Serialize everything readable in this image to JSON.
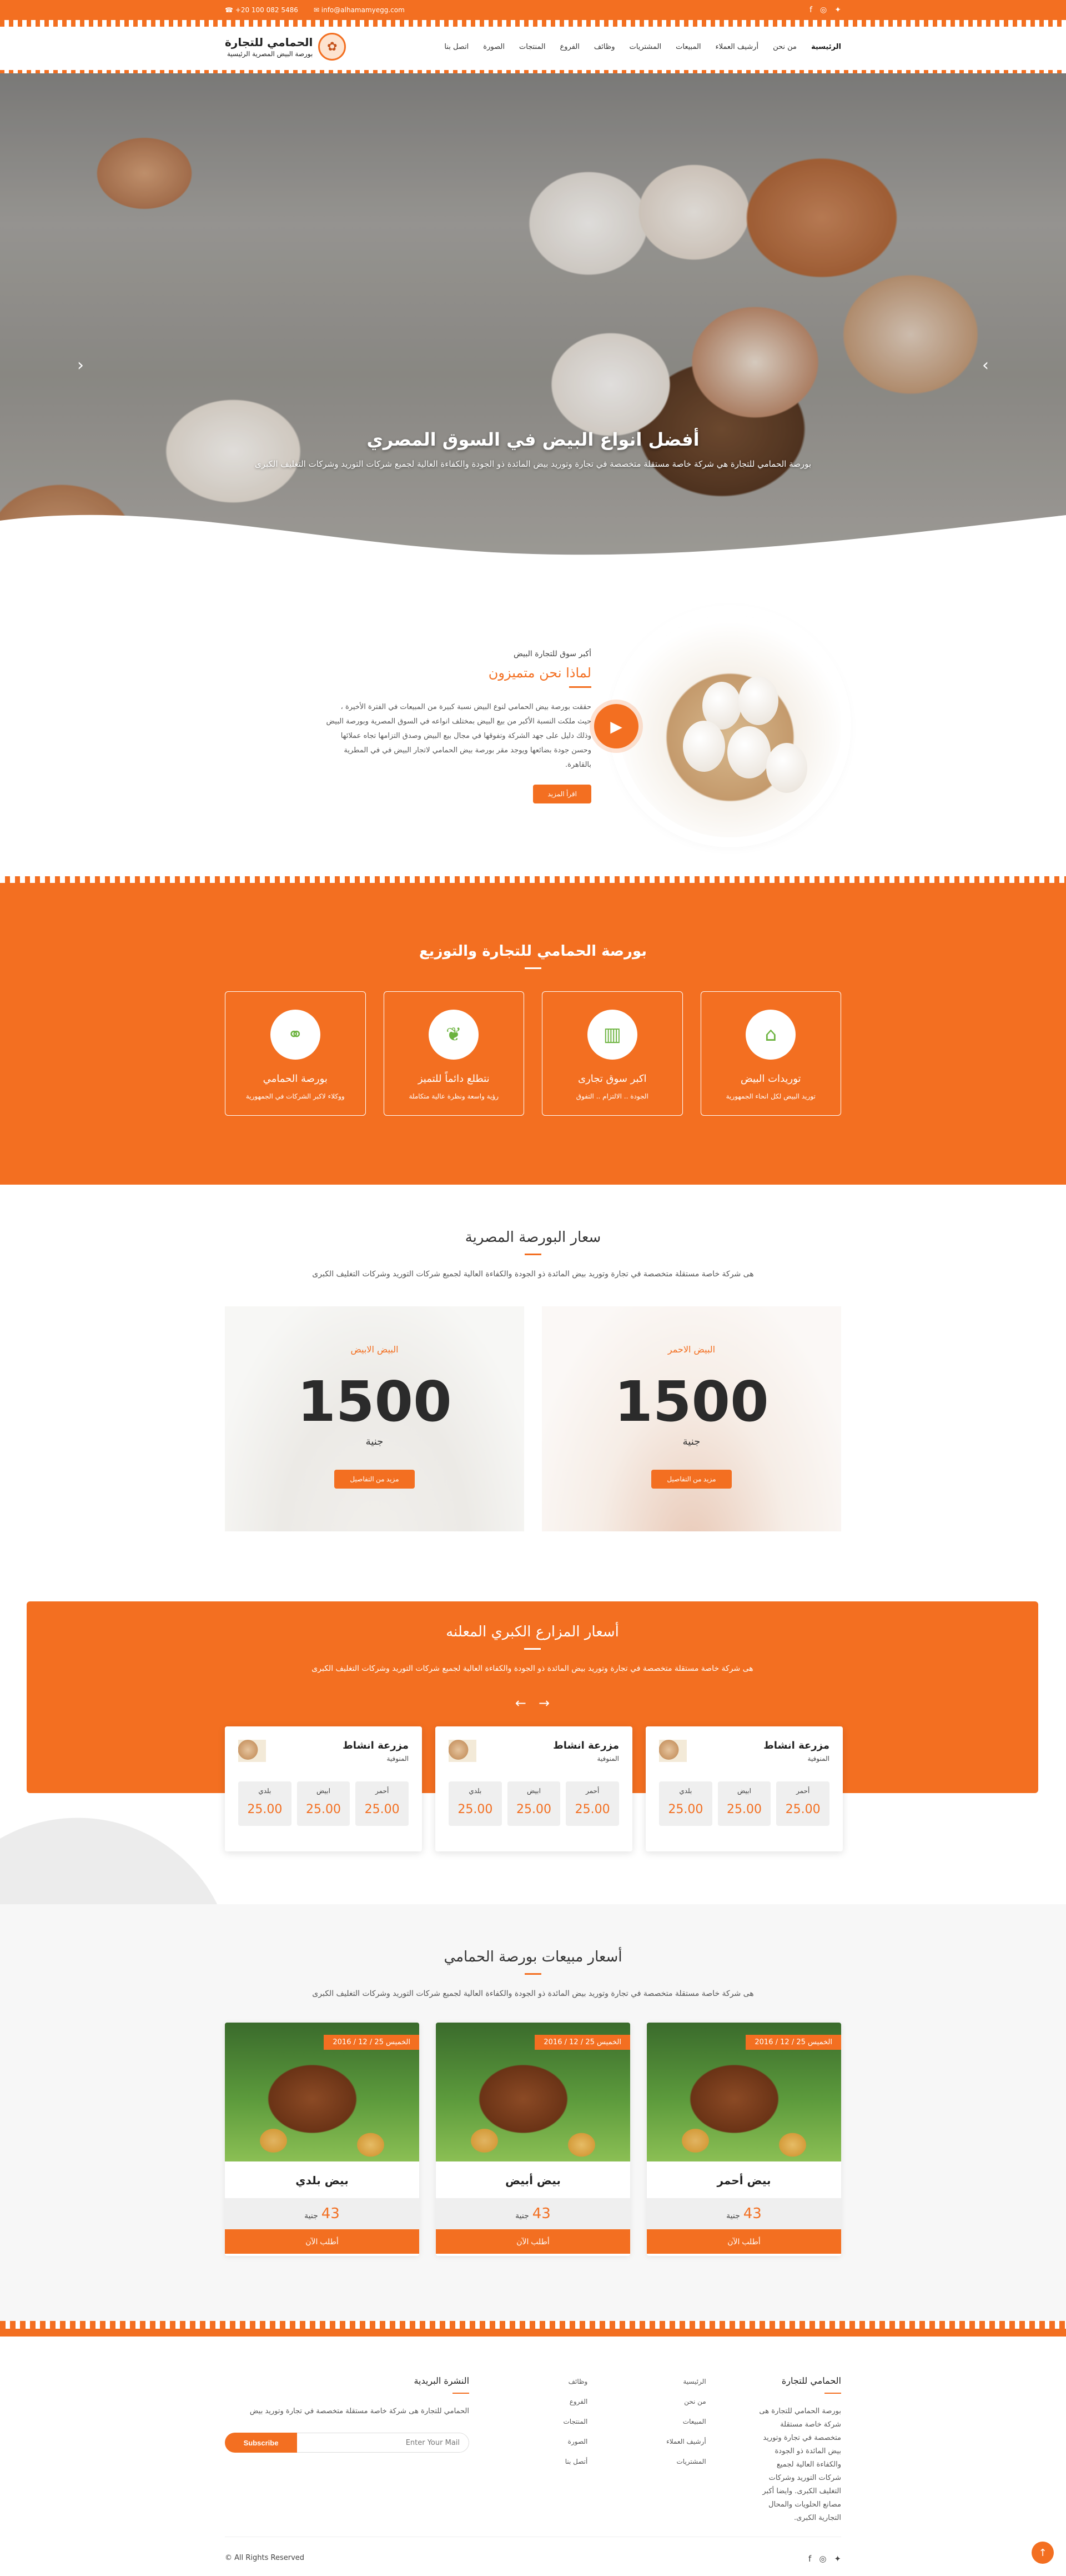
{
  "topbar": {
    "phone": "+20 100 082 5486",
    "email": "info@alhamamyegg.com",
    "social": [
      "facebook-icon",
      "instagram-icon",
      "twitter-icon"
    ]
  },
  "header": {
    "logo_title": "الحمامي للتجارة",
    "logo_subtitle": "بورصة البيض المصرية الرئيسية",
    "nav": [
      "الرئيسية",
      "من نحن",
      "أرشيف العملاء",
      "المبيعات",
      "المشتريات",
      "وظائف",
      "الفروع",
      "المنتجات",
      "الصورة",
      "اتصل بنا"
    ]
  },
  "hero": {
    "title": "أفضل انواع البيض في السوق المصري",
    "subtitle": "بورصة الحمامي للتجارة هي شركة خاصة مستقلة متخصصة في تجارة وتوريد بيض المائدة ذو الجودة والكفاءة العالية لجميع شركات التوريد وشركات التغليف الكبرى"
  },
  "about": {
    "subtitle": "أكبر سوق للتجارة البيض",
    "title": "لماذا نحن متميزون",
    "text": "حققت بورصة بيض الحمامي لنوع البيض نسبة كبيرة من المبيعات في الفترة الأخيرة ، حيث ملكت النسبة الأكبر من بيع البيض بمختلف انواعه في السوق المصرية وبورصة البيض وذلك دليل على جهد الشركة وتفوقها في مجال بيع البيض وصدق التزامها تجاه عملائها وحسن جودة بضائعها ويوجد مقر بورصة بيض الحمامي لاتجار البيض في في المطرية بالقاهرة.",
    "button": "اقرأ المزيد"
  },
  "features": {
    "title": "بورصة الحمامي للتجارة والتوزيع",
    "cards": [
      {
        "icon": "home-icon",
        "title": "توريدات البيض",
        "text": "توريد البيض لكل انحاء الجمهورية"
      },
      {
        "icon": "chart-icon",
        "title": "اكبر سوق تجارى",
        "text": "الجودة .. الالتزام .. التفوق"
      },
      {
        "icon": "leaf-icon",
        "title": "نتطلع دائماً للتميز",
        "text": "رؤية واسعة ونظرة عالية متكاملة"
      },
      {
        "icon": "handshake-icon",
        "title": "بورصة الحمامي",
        "text": "ووكلاء لاكبر الشركات في الجمهورية"
      }
    ]
  },
  "prices": {
    "title": "سعار البورصة المصرية",
    "lead": "هى شركة خاصة مستقلة متخصصة في تجارة وتوريد بيض المائدة ذو الجودة والكفاءة العالية لجميع شركات التوريد وشركات التغليف الكبرى",
    "items": [
      {
        "name": "البيض الاحمر",
        "value": "1500",
        "currency": "جنية",
        "button": "مزيد من التفاصيل"
      },
      {
        "name": "البيض الابيض",
        "value": "1500",
        "currency": "جنية",
        "button": "مزيد من التفاصيل"
      }
    ]
  },
  "farms": {
    "title": "أسعار المزارع الكبري المعلنه",
    "lead": "هى شركة خاصة مستقلة متخصصة في تجارة وتوريد بيض المائدة ذو الجودة والكفاءة العالية لجميع شركات التوريد وشركات التغليف الكبرى",
    "prev": "←",
    "next": "→",
    "cards": [
      {
        "title": "مزرعة انشاط",
        "location": "المنوفية",
        "cells": [
          {
            "k": "أحمر",
            "v": "25.00"
          },
          {
            "k": "ابيض",
            "v": "25.00"
          },
          {
            "k": "بلدي",
            "v": "25.00"
          }
        ]
      },
      {
        "title": "مزرعة انشاط",
        "location": "المنوفية",
        "cells": [
          {
            "k": "أحمر",
            "v": "25.00"
          },
          {
            "k": "ابيض",
            "v": "25.00"
          },
          {
            "k": "بلدي",
            "v": "25.00"
          }
        ]
      },
      {
        "title": "مزرعة انشاط",
        "location": "المنوفية",
        "cells": [
          {
            "k": "أحمر",
            "v": "25.00"
          },
          {
            "k": "ابيض",
            "v": "25.00"
          },
          {
            "k": "بلدي",
            "v": "25.00"
          }
        ]
      }
    ]
  },
  "sales": {
    "title": "أسعار مبيعات بورصة الحمامي",
    "lead": "هى شركة خاصة مستقلة متخصصة في تجارة وتوريد بيض المائدة ذو الجودة والكفاءة العالية لجميع شركات التوريد وشركات التغليف الكبرى",
    "cards": [
      {
        "date": "الخميس 25 / 12 / 2016",
        "name": "بيض أحمر",
        "price": "43",
        "currency": "جنية",
        "button": "أطلب الآن"
      },
      {
        "date": "الخميس 25 / 12 / 2016",
        "name": "بيض أبيض",
        "price": "43",
        "currency": "جنية",
        "button": "أطلب الآن"
      },
      {
        "date": "الخميس 25 / 12 / 2016",
        "name": "بيض بلدي",
        "price": "43",
        "currency": "جنية",
        "button": "أطلب الآن"
      }
    ]
  },
  "footer": {
    "about_title": "الحمامي للتجارة",
    "about_text": "بورصة الحمامي للتجارة هى شركة خاصة مستقلة متخصصة في تجارة وتوريد بيض المائدة ذو الجودة والكفاءة العالية لجميع شركات التوريد وشركات التغليف الكبرى. وايضا أكبر مصانع الحلويات والمحال التجارية الكبرى.",
    "links_col1": [
      "الرئيسية",
      "من نحن",
      "المبيعات",
      "أرشيف العملاء",
      "المشتريات"
    ],
    "links_col2": [
      "وظائف",
      "الفروع",
      "المنتجات",
      "الصورة",
      "أتصل بنا"
    ],
    "newsletter_title": "النشرة البريدية",
    "newsletter_text": "الحمامي للتجارة هى شركة خاصة مستقلة متخصصة في تجارة وتوريد بيض",
    "subscribe": "Subscribe",
    "placeholder": "Enter Your Mail",
    "copyright": "© All Rights Reserved",
    "to_top": "↑"
  },
  "colors": {
    "accent": "#f36f21",
    "icon_green": "#6cb33f"
  }
}
